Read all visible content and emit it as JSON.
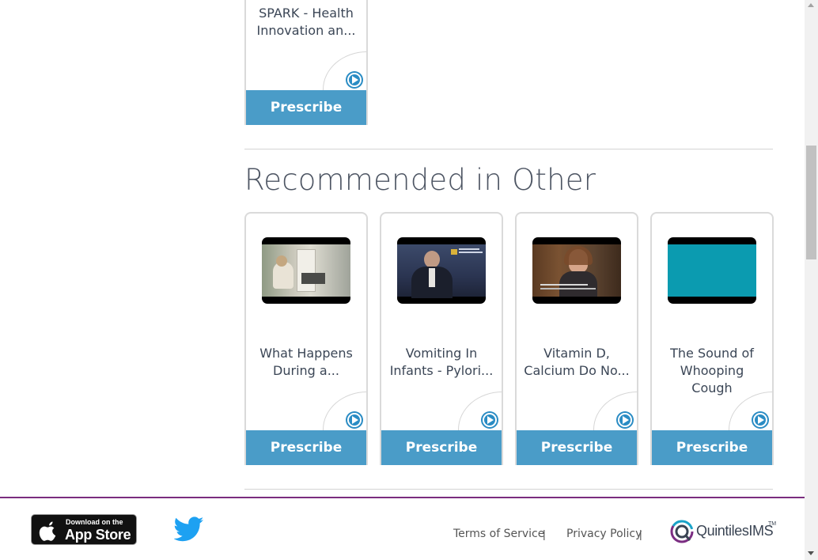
{
  "top_card": {
    "title": "SPARK - Health Innovation an...",
    "button": "Prescribe"
  },
  "section": {
    "title": "Recommended in Other"
  },
  "cards": [
    {
      "title": "What Happens During a...",
      "button": "Prescribe"
    },
    {
      "title": "Vomiting In Infants - Pylori...",
      "button": "Prescribe"
    },
    {
      "title": "Vitamin D, Calcium Do No...",
      "button": "Prescribe"
    },
    {
      "title": "The Sound of Whooping Cough",
      "button": "Prescribe"
    }
  ],
  "footer": {
    "appstore_small": "Download on the",
    "appstore_big": "App Store",
    "terms": "Terms of Service",
    "privacy": "Privacy Policy",
    "separator": "|",
    "logo_text": "QuintilesIMS",
    "logo_tm": "TM"
  },
  "colors": {
    "accent": "#4a9cc8",
    "play": "#2a8cc4",
    "footer_line": "#7a2d7e",
    "teal_thumb": "#0b9bb0"
  },
  "icons": [
    "play-icon",
    "apple-icon",
    "twitter-icon",
    "quintilesims-logo"
  ]
}
